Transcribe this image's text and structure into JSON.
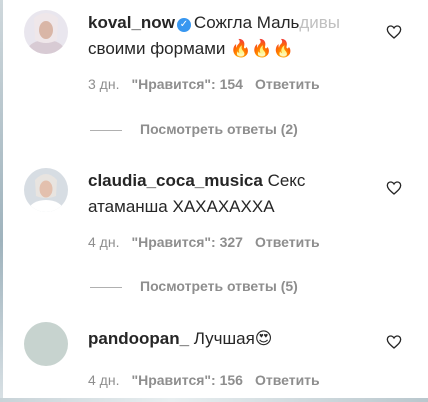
{
  "comments": [
    {
      "username": "koval_now",
      "verified": true,
      "text": "Сожгла Маль",
      "text_faded": "дивы",
      "text_line2": "своими формами 🔥🔥🔥",
      "time": "3 дн.",
      "likes": "\"Нравится\": 154",
      "reply": "Ответить",
      "view_replies": "Посмотреть ответы (2)"
    },
    {
      "username": "claudia_coca_musica",
      "verified": false,
      "text": "Секс",
      "text_line2": "атаманша ХАХАХАХХА",
      "time": "4 дн.",
      "likes": "\"Нравится\": 327",
      "reply": "Ответить",
      "view_replies": "Посмотреть ответы (5)"
    },
    {
      "username": "pandoopan_",
      "verified": false,
      "text": "Лучшая😍",
      "time": "4 дн.",
      "likes": "\"Нравится\": 156",
      "reply": "Ответить"
    }
  ],
  "icons": {
    "like": "heart-outline-icon",
    "verified": "verified-badge-icon"
  },
  "colors": {
    "verified": "#3897f0",
    "meta": "#8e8e8e",
    "text": "#262626"
  }
}
